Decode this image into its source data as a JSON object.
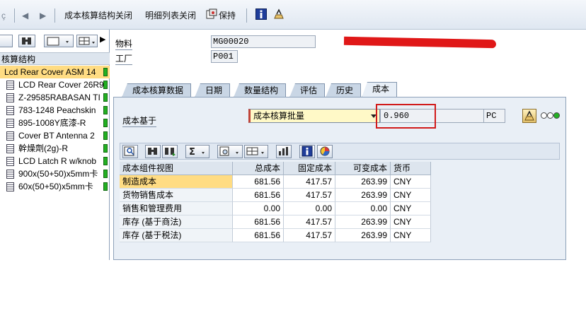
{
  "toolbar": {
    "close_structure_label": "成本核算结构关闭",
    "close_list_label": "明细列表关闭",
    "keep_label": "保持"
  },
  "tree": {
    "header": "核算结构",
    "items": [
      {
        "label": "Lcd Rear Cover ASM 14",
        "selected": true
      },
      {
        "label": "LCD Rear Cover 26R9"
      },
      {
        "label": "Z-29585RABASAN TI"
      },
      {
        "label": "783-1248 Peachskin"
      },
      {
        "label": "895-1008Y底漆-R"
      },
      {
        "label": "Cover BT Antenna 2"
      },
      {
        "label": "幹燥劑(2g)-R"
      },
      {
        "label": "LCD Latch R w/knob"
      },
      {
        "label": "900x(50+50)x5mm卡"
      },
      {
        "label": "60x(50+50)x5mm卡"
      }
    ]
  },
  "header": {
    "material_label": "物料",
    "material_value": "MG00020",
    "plant_label": "工厂",
    "plant_value": "P001"
  },
  "tabs": [
    {
      "label": "成本核算数据"
    },
    {
      "label": "日期"
    },
    {
      "label": "数量结构"
    },
    {
      "label": "评估"
    },
    {
      "label": "历史"
    },
    {
      "label": "成本",
      "active": true
    }
  ],
  "cost_basis": {
    "label": "成本基于",
    "selected_option": "成本核算批量",
    "quantity": "0.960",
    "unit": "PC"
  },
  "grid": {
    "columns": [
      "成本组件视图",
      "总成本",
      "固定成本",
      "可变成本",
      "货币"
    ],
    "rows": [
      {
        "view": "制造成本",
        "total": "681.56",
        "fixed": "417.57",
        "variable": "263.99",
        "currency": "CNY",
        "selected": true
      },
      {
        "view": "货物销售成本",
        "total": "681.56",
        "fixed": "417.57",
        "variable": "263.99",
        "currency": "CNY"
      },
      {
        "view": "销售和管理费用",
        "total": "0.00",
        "fixed": "0.00",
        "variable": "0.00",
        "currency": "CNY"
      },
      {
        "view": "库存 (基于商法)",
        "total": "681.56",
        "fixed": "417.57",
        "variable": "263.99",
        "currency": "CNY"
      },
      {
        "view": "库存 (基于税法)",
        "total": "681.56",
        "fixed": "417.57",
        "variable": "263.99",
        "currency": "CNY"
      }
    ]
  },
  "colors": {
    "selection": "#ffdc83",
    "panel": "#e9eff6",
    "highlight_box": "#d11a1a"
  }
}
